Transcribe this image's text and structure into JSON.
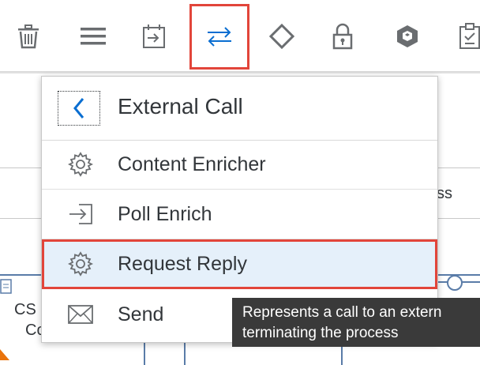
{
  "toolbar": {
    "items": [
      {
        "name": "delete",
        "icon": "trash-icon"
      },
      {
        "name": "menu",
        "icon": "hamburger-menu-icon"
      },
      {
        "name": "events",
        "icon": "calendar-arrow-icon"
      },
      {
        "name": "call",
        "icon": "swap-arrows-icon",
        "highlighted": true
      },
      {
        "name": "routing",
        "icon": "diamond-icon"
      },
      {
        "name": "security",
        "icon": "lock-icon"
      },
      {
        "name": "persistence",
        "icon": "cube-icon"
      },
      {
        "name": "validator",
        "icon": "clipboard-check-icon"
      }
    ]
  },
  "canvas": {
    "partial_texts": [
      "ss",
      "CS",
      "Co"
    ]
  },
  "popover": {
    "title": "External Call",
    "items": [
      {
        "label": "Content Enricher",
        "icon": "gear-icon"
      },
      {
        "label": "Poll Enrich",
        "icon": "sign-in-arrow-icon"
      },
      {
        "label": "Request Reply",
        "icon": "gear-icon",
        "selected": true
      },
      {
        "label": "Send",
        "icon": "envelope-icon"
      }
    ]
  },
  "tooltip": {
    "line1": "Represents a call to an extern",
    "line2": "terminating the process"
  },
  "colors": {
    "highlight": "#e2453a",
    "icon": "#6a6d70",
    "accent_icon": "#0a6ed1",
    "selected_bg": "#e5f0fa",
    "tooltip_bg": "#3a3a3a"
  }
}
